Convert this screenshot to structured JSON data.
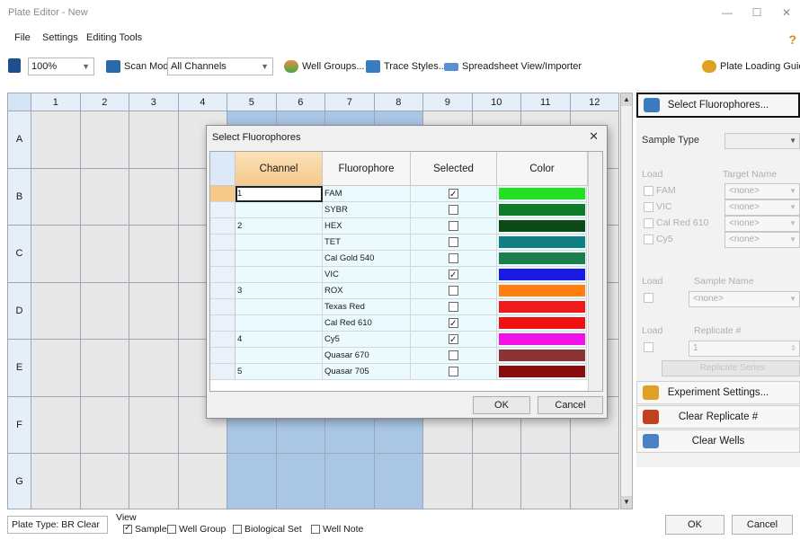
{
  "window": {
    "title": "Plate Editor - New",
    "minimize": "—",
    "maximize": "☐",
    "close": "✕"
  },
  "menu": {
    "items": [
      "File",
      "Settings",
      "Editing Tools"
    ],
    "help": "?"
  },
  "toolbar": {
    "zoom": "100%",
    "scan_mode_label": "Scan Mode",
    "scan_mode_value": "All Channels",
    "well_groups": "Well Groups...",
    "trace_styles": "Trace Styles...",
    "spreadsheet": "Spreadsheet View/Importer",
    "plate_loading_guide": "Plate Loading Guide"
  },
  "plate": {
    "columns": [
      "1",
      "2",
      "3",
      "4",
      "5",
      "6",
      "7",
      "8",
      "9",
      "10",
      "11",
      "12"
    ],
    "rows": [
      "A",
      "B",
      "C",
      "D",
      "E",
      "F",
      "G"
    ],
    "selected_columns": [
      5,
      6,
      7,
      8
    ]
  },
  "right_panel": {
    "select_fluorophores": "Select Fluorophores...",
    "sample_type_label": "Sample Type",
    "load_label": "Load",
    "target_name_label": "Target Name",
    "targets": [
      {
        "name": "FAM",
        "value": "<none>"
      },
      {
        "name": "VIC",
        "value": "<none>"
      },
      {
        "name": "Cal Red 610",
        "value": "<none>"
      },
      {
        "name": "Cy5",
        "value": "<none>"
      }
    ],
    "sample_load_label": "Load",
    "sample_name_label": "Sample Name",
    "sample_name_value": "<none>",
    "replicate_load_label": "Load",
    "replicate_label": "Replicate #",
    "replicate_value": "1",
    "replicate_series": "Replicate Series",
    "experiment_settings": "Experiment Settings...",
    "clear_replicate": "Clear Replicate #",
    "clear_wells": "Clear Wells"
  },
  "bottom": {
    "plate_type": "Plate Type: BR Clear",
    "view_label": "View",
    "view_options": [
      {
        "label": "Sample",
        "checked": true
      },
      {
        "label": "Well Group",
        "checked": false
      },
      {
        "label": "Biological Set",
        "checked": false
      },
      {
        "label": "Well Note",
        "checked": false
      }
    ],
    "ok": "OK",
    "cancel": "Cancel"
  },
  "dialog": {
    "title": "Select Fluorophores",
    "close": "✕",
    "headers": {
      "channel": "Channel",
      "fluorophore": "Fluorophore",
      "selected": "Selected",
      "color": "Color"
    },
    "rows": [
      {
        "channel": "1",
        "fluorophore": "FAM",
        "selected": true,
        "color": "#22e022"
      },
      {
        "channel": "",
        "fluorophore": "SYBR",
        "selected": false,
        "color": "#0f7a2a"
      },
      {
        "channel": "2",
        "fluorophore": "HEX",
        "selected": false,
        "color": "#0c4a16"
      },
      {
        "channel": "",
        "fluorophore": "TET",
        "selected": false,
        "color": "#0f7f80"
      },
      {
        "channel": "",
        "fluorophore": "Cal Gold 540",
        "selected": false,
        "color": "#1a7f4d"
      },
      {
        "channel": "",
        "fluorophore": "VIC",
        "selected": true,
        "color": "#1a1ae6"
      },
      {
        "channel": "3",
        "fluorophore": "ROX",
        "selected": false,
        "color": "#ff7f10"
      },
      {
        "channel": "",
        "fluorophore": "Texas Red",
        "selected": false,
        "color": "#f01a1a"
      },
      {
        "channel": "",
        "fluorophore": "Cal Red 610",
        "selected": true,
        "color": "#f01212"
      },
      {
        "channel": "4",
        "fluorophore": "Cy5",
        "selected": true,
        "color": "#f212e8"
      },
      {
        "channel": "",
        "fluorophore": "Quasar 670",
        "selected": false,
        "color": "#8a3434"
      },
      {
        "channel": "5",
        "fluorophore": "Quasar 705",
        "selected": false,
        "color": "#8a0c0c"
      }
    ],
    "ok": "OK",
    "cancel": "Cancel"
  }
}
